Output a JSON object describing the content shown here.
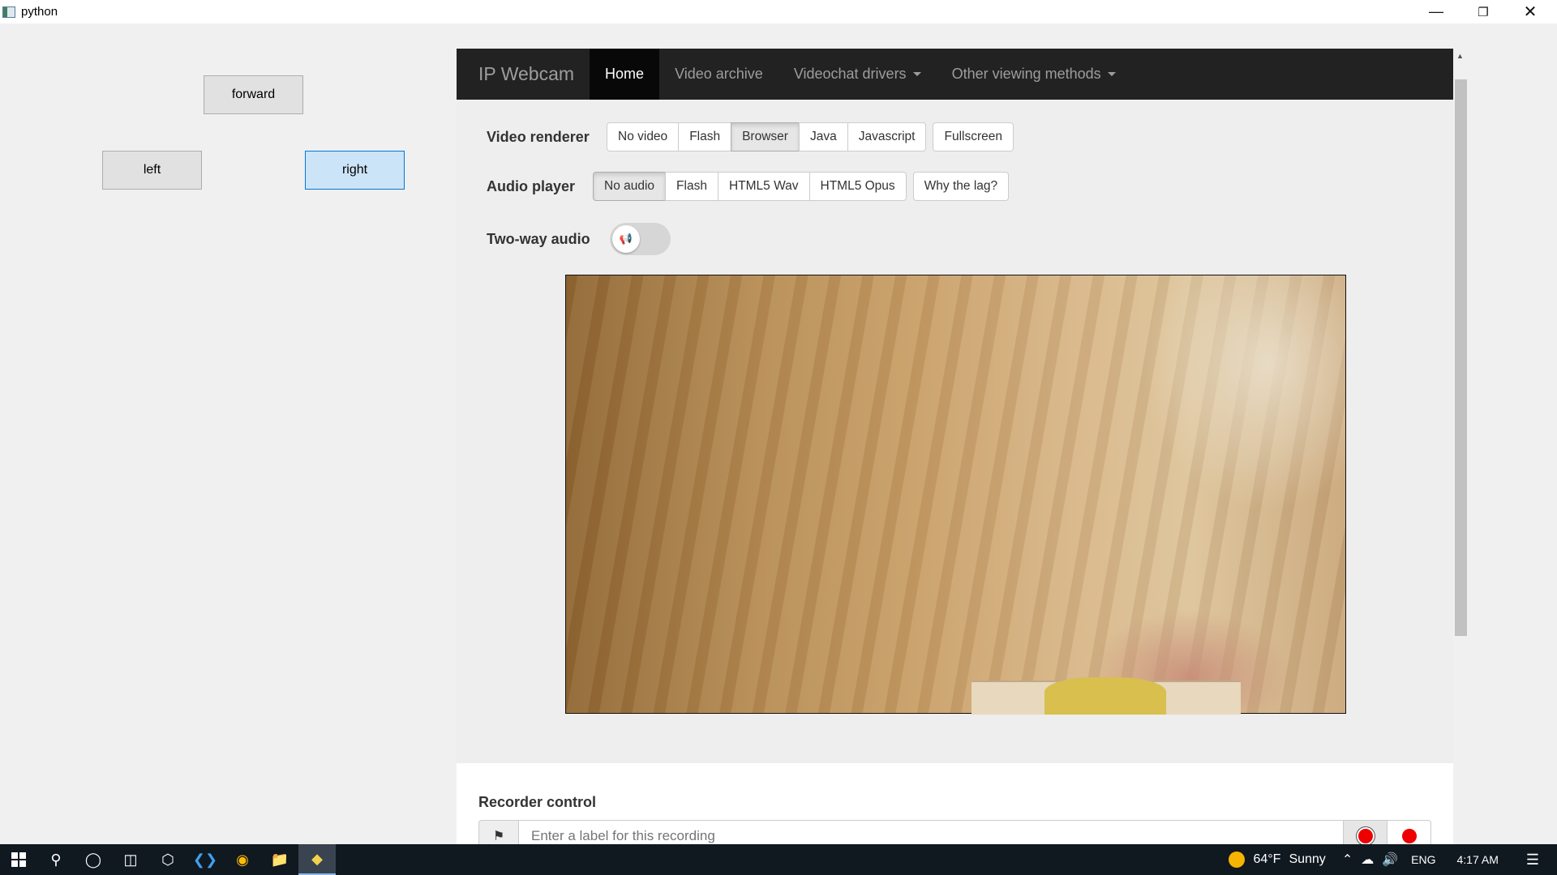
{
  "window": {
    "title": "python"
  },
  "controls": {
    "forward": "forward",
    "left": "left",
    "right": "right"
  },
  "webcam": {
    "brand": "IP Webcam",
    "nav": [
      "Home",
      "Video archive",
      "Videochat drivers",
      "Other viewing methods"
    ],
    "video_renderer": {
      "label": "Video renderer",
      "options": [
        "No video",
        "Flash",
        "Browser",
        "Java",
        "Javascript"
      ],
      "selected": "Browser",
      "extra": "Fullscreen"
    },
    "audio_player": {
      "label": "Audio player",
      "options": [
        "No audio",
        "Flash",
        "HTML5 Wav",
        "HTML5 Opus"
      ],
      "selected": "No audio",
      "extra": "Why the lag?"
    },
    "two_way_audio": {
      "label": "Two-way audio",
      "enabled": false
    },
    "recorder": {
      "title": "Recorder control",
      "placeholder": "Enter a label for this recording"
    }
  },
  "taskbar": {
    "weather": {
      "temp": "64°F",
      "condition": "Sunny"
    },
    "language": "ENG",
    "time": "4:17 AM"
  }
}
